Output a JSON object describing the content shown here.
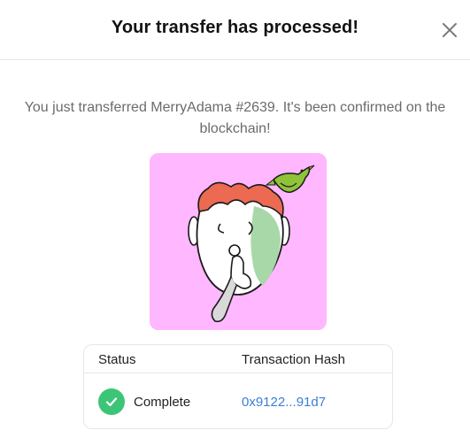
{
  "modal": {
    "title": "Your transfer has processed!",
    "close_icon": "close-icon",
    "message": "You just transferred MerryAdama #2639. It's been confirmed on the blockchain!"
  },
  "nft": {
    "background_color": "#ffb7ff"
  },
  "transaction": {
    "headers": {
      "status": "Status",
      "hash": "Transaction Hash"
    },
    "status": {
      "icon": "check-circle-icon",
      "label": "Complete",
      "color": "#3cc576"
    },
    "hash": "0x9122...91d7",
    "link_color": "#3d7fd6"
  }
}
